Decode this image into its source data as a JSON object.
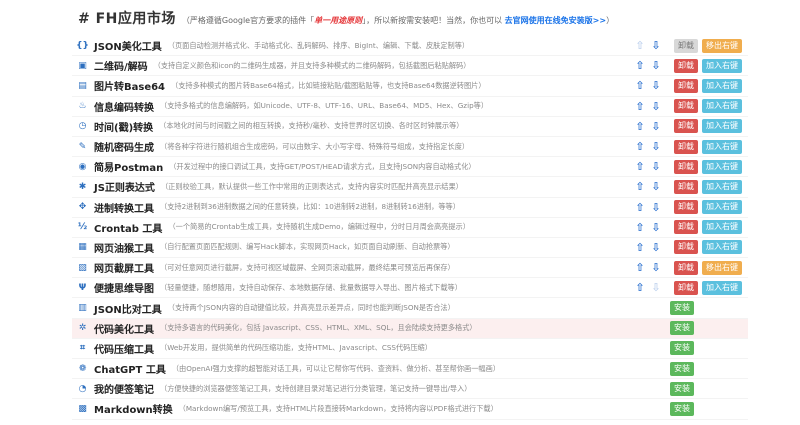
{
  "header": {
    "title": "# FH应用市场",
    "note_a": "（严格遵循Google官方要求的插件「",
    "warn": "单一用途原则",
    "note_b": "」，所以新按需安装吧！当然，你也可以",
    "link": "去官网使用在线免安装版>>",
    "note_c": "）"
  },
  "labels": {
    "uninstall": "卸载",
    "add": "加入右键",
    "remove": "移出右键",
    "install": "安装"
  },
  "arrows": {
    "up": "⇧",
    "down": "⇩"
  },
  "tools": [
    {
      "name": "JSON美化工具",
      "desc": "（页面自动检测并格式化、手动格式化、乱码解码、排序、BigInt、编辑、下载、皮肤定制等）",
      "icon": "{}",
      "state": "installed",
      "menu": "remove",
      "uninstall_disabled": true,
      "up_dim": true,
      "down_dim": false
    },
    {
      "name": "二维码/解码",
      "desc": "（支持自定义颜色和icon的二维码生成器，并且支持多种模式的二维码解码，包括截图后粘贴解码）",
      "icon": "▣",
      "state": "installed",
      "menu": "add"
    },
    {
      "name": "图片转Base64",
      "desc": "（支持多种模式的图片转Base64格式，比如链接粘贴/截图粘贴等，也支持Base64数据逆转图片）",
      "icon": "▤",
      "state": "installed",
      "menu": "add"
    },
    {
      "name": "信息编码转换",
      "desc": "（支持多格式的信息编解码，如Unicode、UTF-8、UTF-16、URL、Base64、MD5、Hex、Gzip等）",
      "icon": "♨",
      "state": "installed",
      "menu": "add"
    },
    {
      "name": "时间(戳)转换",
      "desc": "（本地化时间与时间戳之间的相互转换，支持秒/毫秒、支持世界时区切换、各时区时钟展示等）",
      "icon": "◷",
      "state": "installed",
      "menu": "add"
    },
    {
      "name": "随机密码生成",
      "desc": "（将各种字符进行随机组合生成密码，可以由数字、大小写字母、特殊符号组成，支持指定长度）",
      "icon": "✎",
      "state": "installed",
      "menu": "add"
    },
    {
      "name": "简易Postman",
      "desc": "（开发过程中的接口调试工具，支持GET/POST/HEAD请求方式，且支持JSON内容自动格式化）",
      "icon": "◉",
      "state": "installed",
      "menu": "add"
    },
    {
      "name": "JS正则表达式",
      "desc": "（正则校验工具，默认提供一些工作中常用的正则表达式，支持内容实时匹配并高亮显示结果）",
      "icon": "✱",
      "state": "installed",
      "menu": "add"
    },
    {
      "name": "进制转换工具",
      "desc": "（支持2进制到36进制数据之间的任意转换，比如：10进制转2进制，8进制转16进制，等等）",
      "icon": "✥",
      "state": "installed",
      "menu": "add"
    },
    {
      "name": "Crontab 工具",
      "desc": "（一个简易的Crontab生成工具，支持随机生成Demo，编辑过程中，分时日月周会高亮提示）",
      "icon": "½",
      "state": "installed",
      "menu": "add"
    },
    {
      "name": "网页油猴工具",
      "desc": "（自行配置页面匹配规则、编写Hack脚本，实现网页Hack，如页面自动刷新、自动抢票等）",
      "icon": "▦",
      "state": "installed",
      "menu": "add"
    },
    {
      "name": "网页截屏工具",
      "desc": "（可对任意网页进行截屏，支持可视区域截屏、全网页滚动截屏，最终结果可预览后再保存）",
      "icon": "▧",
      "state": "installed",
      "menu": "remove"
    },
    {
      "name": "便捷思维导图",
      "desc": "（轻量便捷，随想随用，支持自动保存、本地数据存储、批量数据导入导出、图片格式下载等）",
      "icon": "Ψ",
      "state": "installed",
      "menu": "add",
      "up_dim": false,
      "down_dim": true
    },
    {
      "name": "JSON比对工具",
      "desc": "（支持两个JSON内容的自动键值比较，并高亮显示差异点，同时也能判断JSON是否合法）",
      "icon": "▥",
      "state": "available"
    },
    {
      "name": "代码美化工具",
      "desc": "（支持多语言的代码美化，包括 Javascript、CSS、HTML、XML、SQL，且会陆续支持更多格式）",
      "icon": "✲",
      "state": "available",
      "highlight": true
    },
    {
      "name": "代码压缩工具",
      "desc": "（Web开发用，提供简单的代码压缩功能，支持HTML、Javascript、CSS代码压缩）",
      "icon": "⌗",
      "state": "available"
    },
    {
      "name": "ChatGPT 工具",
      "desc": "（由OpenAI强力支撑的超智能对话工具，可以让它帮你写代码、查资料、做分析、甚至帮你画一幅画）",
      "icon": "❁",
      "state": "available"
    },
    {
      "name": "我的便签笔记",
      "desc": "（方便快捷的浏览器便签笔记工具，支持创建目录对笔记进行分类管理，笔记支持一键导出/导入）",
      "icon": "◔",
      "state": "available"
    },
    {
      "name": "Markdown转换",
      "desc": "（Markdown编写/预览工具，支持HTML片段直接转Markdown，支持将内容以PDF格式进行下载）",
      "icon": "▩",
      "state": "available"
    }
  ]
}
